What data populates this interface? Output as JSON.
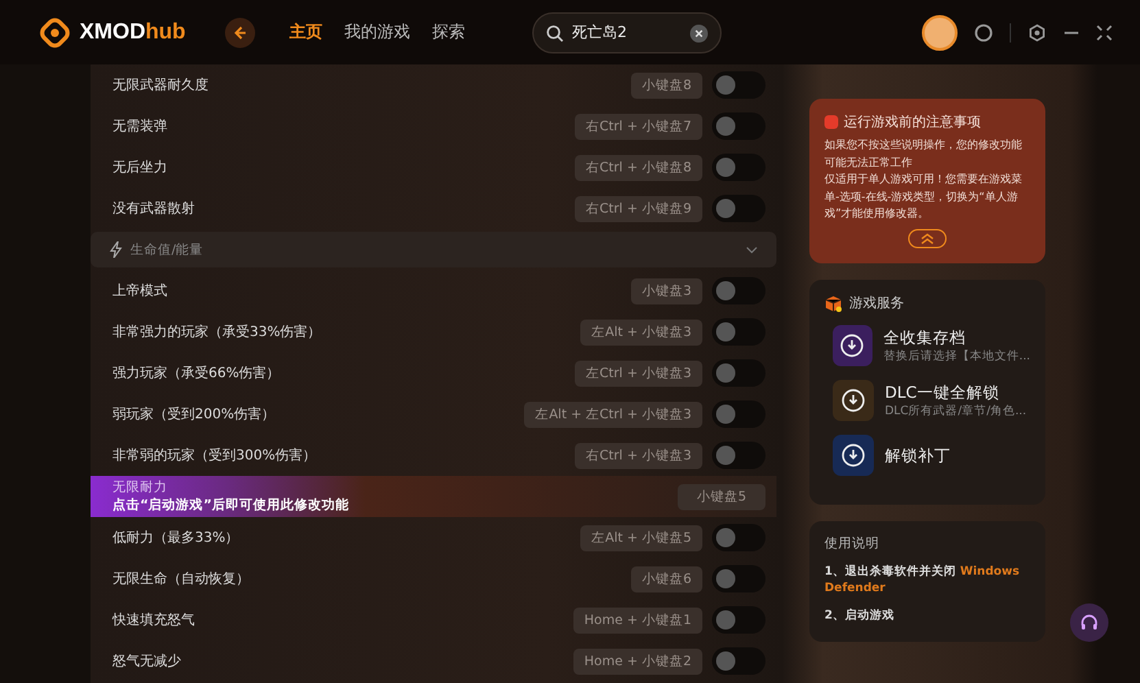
{
  "app": {
    "logo_text": "XMOD",
    "logo_accent": "hub"
  },
  "nav": [
    {
      "label": "主页",
      "selected": true
    },
    {
      "label": "我的游戏",
      "selected": false
    },
    {
      "label": "探索",
      "selected": false
    }
  ],
  "search": {
    "value": "死亡岛2"
  },
  "cheats": [
    {
      "kind": "toggle",
      "label": "无限武器耐久度",
      "hotkey": "小键盘8",
      "on": false
    },
    {
      "kind": "toggle",
      "label": "无需装弹",
      "hotkey": "右Ctrl + 小键盘7",
      "on": false
    },
    {
      "kind": "toggle",
      "label": "无后坐力",
      "hotkey": "右Ctrl + 小键盘8",
      "on": false
    },
    {
      "kind": "toggle",
      "label": "没有武器散射",
      "hotkey": "右Ctrl + 小键盘9",
      "on": false
    },
    {
      "kind": "section",
      "label": "生命值/能量",
      "expanded": true
    },
    {
      "kind": "toggle",
      "label": "上帝模式",
      "hotkey": "小键盘3",
      "on": false
    },
    {
      "kind": "toggle",
      "label": "非常强力的玩家（承受33%伤害）",
      "hotkey": "左Alt + 小键盘3",
      "on": false
    },
    {
      "kind": "toggle",
      "label": "强力玩家（承受66%伤害）",
      "hotkey": "左Ctrl + 小键盘3",
      "on": false
    },
    {
      "kind": "toggle",
      "label": "弱玩家（受到200%伤害）",
      "hotkey": "左Alt + 左Ctrl + 小键盘3",
      "on": false
    },
    {
      "kind": "toggle",
      "label": "非常弱的玩家（受到300%伤害）",
      "hotkey": "右Ctrl + 小键盘3",
      "on": false
    },
    {
      "kind": "locked",
      "label": "无限耐力",
      "note": "点击“启动游戏”后即可使用此修改功能",
      "hotkey": "小键盘5"
    },
    {
      "kind": "toggle",
      "label": "低耐力（最多33%）",
      "hotkey": "左Alt + 小键盘5",
      "on": false
    },
    {
      "kind": "toggle",
      "label": "无限生命（自动恢复）",
      "hotkey": "小键盘6",
      "on": false
    },
    {
      "kind": "toggle",
      "label": "快速填充怒气",
      "hotkey": "Home + 小键盘1",
      "on": false
    },
    {
      "kind": "toggle",
      "label": "怒气无减少",
      "hotkey": "Home + 小键盘2",
      "on": false
    }
  ],
  "notice": {
    "title": "运行游戏前的注意事项",
    "paragraphs": [
      "如果您不按这些说明操作，您的修改功能可能无法正常工作",
      "仅适用于单人游戏可用！您需要在游戏菜单-选项-在线-游戏类型，切换为“单人游戏”才能使用修改器。"
    ]
  },
  "services": {
    "title": "游戏服务",
    "items": [
      {
        "title": "全收集存档",
        "subtitle": "替换后请选择【本地文件...",
        "color": "#3b1f5e"
      },
      {
        "title": "DLC一键全解锁",
        "subtitle": "DLC所有武器/章节/角色...",
        "color": "#3a2a18"
      },
      {
        "title": "解锁补丁",
        "color": "#172a55"
      }
    ]
  },
  "usage": {
    "title": "使用说明",
    "steps": [
      "1、退出杀毒软件并关闭 **Windows Defender**",
      "2、启动游戏"
    ]
  }
}
